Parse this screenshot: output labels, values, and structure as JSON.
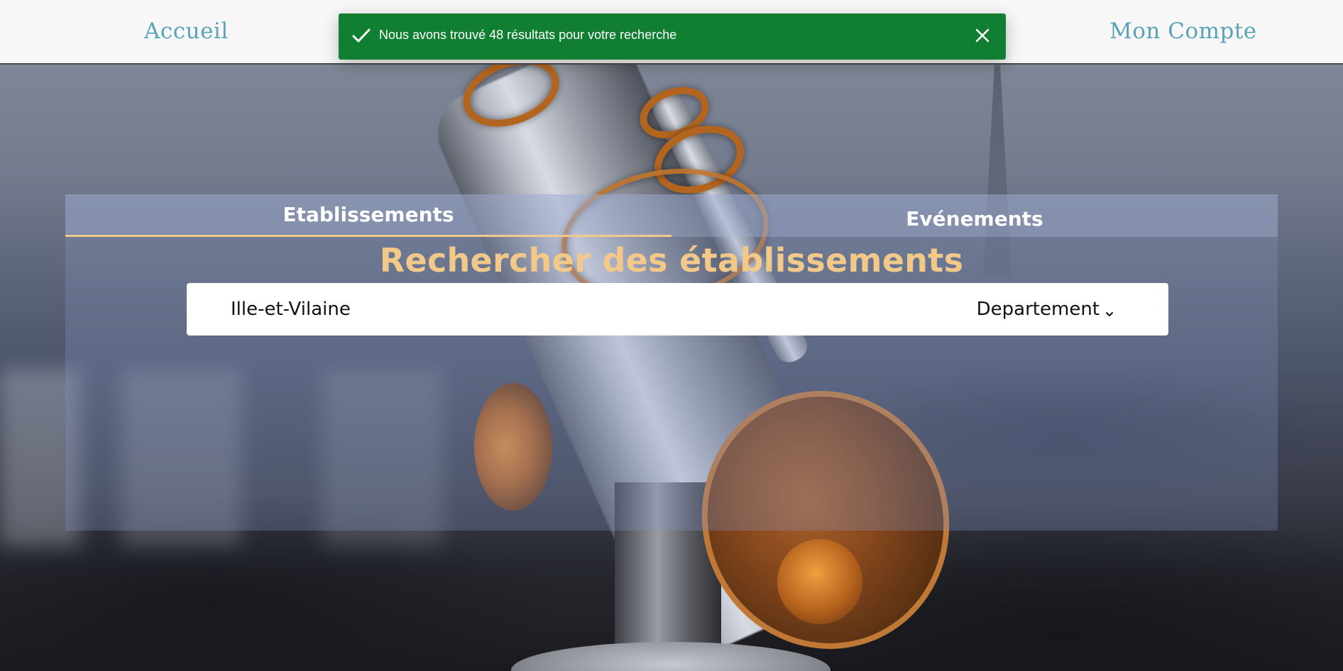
{
  "nav": {
    "home_label": "Accueil",
    "account_label": "Mon Compte"
  },
  "toast": {
    "message": "Nous avons trouvé 48 résultats pour votre recherche",
    "type": "success",
    "color": "#107f32"
  },
  "tabs": [
    {
      "label": "Etablissements",
      "active": true
    },
    {
      "label": "Evénements",
      "active": false
    }
  ],
  "search": {
    "title": "Rechercher des établissements",
    "value": "Ille-et-Vilaine",
    "filter_selected": "Departement"
  },
  "colors": {
    "accent": "#f3c98a",
    "nav_link": "#5aa3b8",
    "nav_bg": "#f7f7f7"
  },
  "icons": {
    "toast_status": "check-icon",
    "toast_close": "close-icon",
    "filter_dropdown": "chevron-down-icon"
  }
}
